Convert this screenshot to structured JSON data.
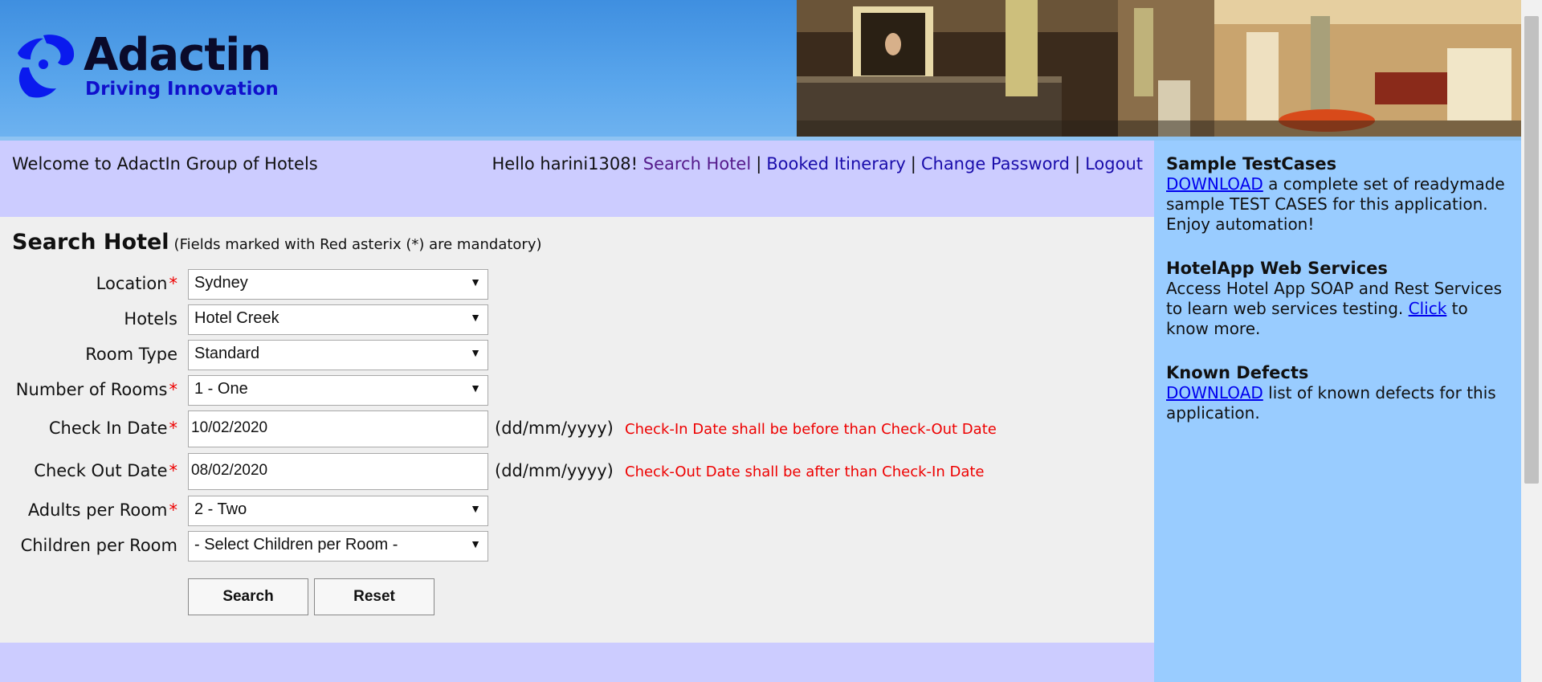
{
  "brand": {
    "name": "Adactin",
    "tagline": "Driving Innovation"
  },
  "header": {
    "welcome": "Welcome to AdactIn Group of Hotels",
    "greeting": "Hello harini1308!",
    "nav": {
      "search_hotel": "Search Hotel",
      "booked_itinerary": "Booked Itinerary",
      "change_password": "Change Password",
      "logout": "Logout",
      "separator": "|"
    }
  },
  "form": {
    "title": "Search Hotel",
    "note": "(Fields marked with Red asterix (*) are mandatory)",
    "required_mark": "*",
    "date_format": "(dd/mm/yyyy)",
    "fields": {
      "location": {
        "label": "Location",
        "value": "Sydney"
      },
      "hotels": {
        "label": "Hotels",
        "value": "Hotel Creek"
      },
      "room_type": {
        "label": "Room Type",
        "value": "Standard"
      },
      "rooms": {
        "label": "Number of Rooms",
        "value": "1 - One"
      },
      "check_in": {
        "label": "Check In Date",
        "value": "10/02/2020",
        "error": "Check-In Date shall be before than Check-Out Date"
      },
      "check_out": {
        "label": "Check Out Date",
        "value": "08/02/2020",
        "error": "Check-Out Date shall be after than Check-In Date"
      },
      "adults": {
        "label": "Adults per Room",
        "value": "2 - Two"
      },
      "children": {
        "label": "Children per Room",
        "value": "- Select Children per Room -"
      }
    },
    "buttons": {
      "search": "Search",
      "reset": "Reset"
    }
  },
  "sidebar": {
    "testcases": {
      "title": "Sample TestCases",
      "link": "DOWNLOAD",
      "text": "a complete set of readymade sample TEST CASES for this application. Enjoy automation!"
    },
    "webservices": {
      "title": "HotelApp Web Services",
      "text": "Access Hotel App SOAP and Rest Services to learn web services testing.",
      "link": "Click",
      "text2": "to know more."
    },
    "defects": {
      "title": "Known Defects",
      "link": "DOWNLOAD",
      "text": "list of known defects for this application."
    }
  },
  "colors": {
    "header_blue": "#4a9be6",
    "nav_lavender": "#ccccff",
    "form_grey": "#efefef",
    "sidebar_blue": "#99ccff",
    "error_red": "#ee0000"
  },
  "icons": {
    "logo": "adactin-swirl-logo",
    "dropdown": "triangle-down-icon"
  }
}
